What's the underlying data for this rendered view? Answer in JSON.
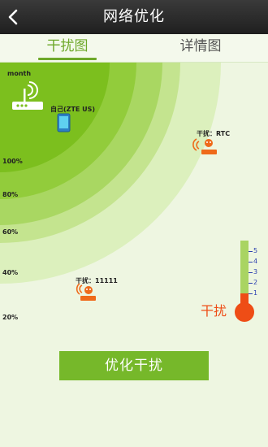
{
  "header": {
    "title": "网络优化",
    "back_icon": "back-arrow-icon"
  },
  "tabs": [
    {
      "label": "干扰图",
      "active": true
    },
    {
      "label": "详情图",
      "active": false
    }
  ],
  "graph": {
    "month_label": "month",
    "self_label": "自己(ZTE US)",
    "percent_labels": [
      "100%",
      "80%",
      "60%",
      "40%",
      "20%"
    ],
    "interferers": [
      {
        "label": "干扰：RTC",
        "icon": "interference-source-icon"
      },
      {
        "label": "干扰：11111",
        "icon": "interference-source-icon"
      }
    ],
    "ring_colors": [
      "#7cbf1e",
      "#92cc3b",
      "#a9d762",
      "#c4e48f",
      "#dcf0bd"
    ]
  },
  "thermometer": {
    "label": "干扰",
    "scale": [
      "5",
      "4",
      "3",
      "2",
      "1"
    ],
    "level": 1,
    "max": 5,
    "fill_color": "#ee4d16",
    "tube_color": "#a9d462"
  },
  "actions": {
    "optimize_label": "优化干扰"
  }
}
